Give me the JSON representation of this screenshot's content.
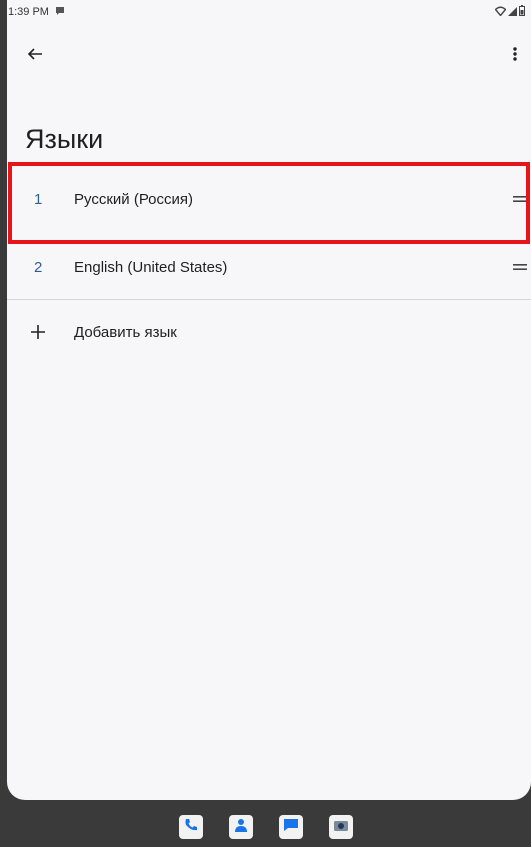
{
  "status_bar": {
    "time": "1:39 PM"
  },
  "app_bar": {
    "back_icon": "arrow-left-icon",
    "more_icon": "more-vertical-icon"
  },
  "page": {
    "title": "Языки"
  },
  "languages": [
    {
      "number": "1",
      "label": "Русский (Россия)",
      "highlighted": true
    },
    {
      "number": "2",
      "label": "English (United States)",
      "highlighted": false
    }
  ],
  "add_language": {
    "label": "Добавить язык"
  },
  "dock": {
    "apps": [
      "phone-icon",
      "contacts-icon",
      "messages-icon",
      "camera-icon"
    ]
  },
  "colors": {
    "accent_number": "#2f5e8f",
    "highlight": "#e8141b",
    "background": "#f7f7f9"
  }
}
